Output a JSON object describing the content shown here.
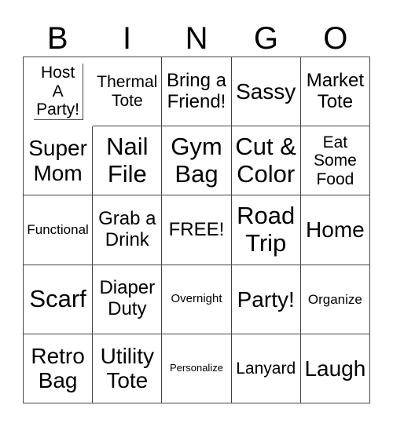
{
  "header": {
    "letters": [
      "B",
      "I",
      "N",
      "G",
      "O"
    ]
  },
  "board": {
    "rows": [
      [
        "Host A Party!",
        "Thermal Tote",
        "Bring a Friend!",
        "Sassy",
        "Market Tote"
      ],
      [
        "Super Mom",
        "Nail File",
        "Gym Bag",
        "Cut & Color",
        "Eat Some Food"
      ],
      [
        "Functional",
        "Grab a Drink",
        "FREE!",
        "Road Trip",
        "Home"
      ],
      [
        "Scarf",
        "Diaper Duty",
        "Overnight",
        "Party!",
        "Organize"
      ],
      [
        "Retro Bag",
        "Utility Tote",
        "Personalize",
        "Lanyard",
        "Laugh"
      ]
    ],
    "cells": {
      "r0c0": "Host A Party!",
      "r0c1": "Thermal Tote",
      "r0c2": "Bring a Friend!",
      "r0c3": "Sassy",
      "r0c4": "Market Tote",
      "r1c0": "Super Mom",
      "r1c1": "Nail File",
      "r1c2": "Gym Bag",
      "r1c3": "Cut & Color",
      "r1c4": "Eat Some Food",
      "r2c0": "Functional",
      "r2c1": "Grab a Drink",
      "r2c2": "FREE!",
      "r2c3": "Road Trip",
      "r2c4": "Home",
      "r3c0": "Scarf",
      "r3c1": "Diaper Duty",
      "r3c2": "Overnight",
      "r3c3": "Party!",
      "r3c4": "Organize",
      "r4c0": "Retro Bag",
      "r4c1": "Utility Tote",
      "r4c2": "Personalize",
      "r4c3": "Lanyard",
      "r4c4": "Laugh"
    }
  }
}
